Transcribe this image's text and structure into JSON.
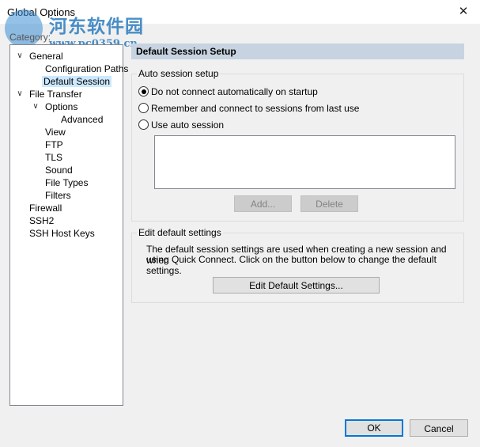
{
  "window": {
    "title": "Global Options",
    "close_glyph": "✕"
  },
  "watermark": {
    "text": "河东软件园",
    "url": "www.pc0359.cn"
  },
  "sidebar": {
    "label": "Category:",
    "items": [
      {
        "label": "General",
        "expanded": true
      },
      {
        "label": "Configuration Paths"
      },
      {
        "label": "Default Session",
        "selected": true
      },
      {
        "label": "File Transfer",
        "expanded": true
      },
      {
        "label": "Options",
        "expanded": true
      },
      {
        "label": "Advanced"
      },
      {
        "label": "View"
      },
      {
        "label": "FTP"
      },
      {
        "label": "TLS"
      },
      {
        "label": "Sound"
      },
      {
        "label": "File Types"
      },
      {
        "label": "Filters"
      },
      {
        "label": "Firewall"
      },
      {
        "label": "SSH2"
      },
      {
        "label": "SSH Host Keys"
      }
    ]
  },
  "main": {
    "header": "Default Session Setup",
    "auto_session": {
      "legend": "Auto session setup",
      "options": [
        {
          "label": "Do not connect automatically on startup",
          "selected": true
        },
        {
          "label": "Remember and connect to sessions from last use",
          "selected": false
        },
        {
          "label": "Use auto session",
          "selected": false
        }
      ],
      "add_label": "Add...",
      "delete_label": "Delete"
    },
    "edit_defaults": {
      "legend": "Edit default settings",
      "description_line1": "The default session settings are used when creating a new session and when",
      "description_line2": "using Quick Connect.  Click on the button below to change the default settings.",
      "button_label": "Edit Default Settings..."
    }
  },
  "footer": {
    "ok_label": "OK",
    "cancel_label": "Cancel"
  },
  "colors": {
    "accent": "#0078d7",
    "selection": "#cce8ff",
    "header_bar": "#c7d3e0"
  }
}
